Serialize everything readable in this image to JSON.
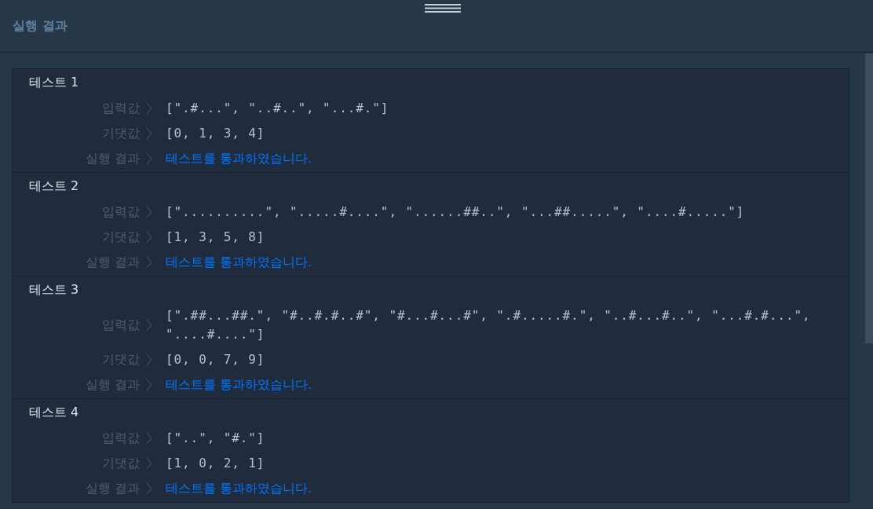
{
  "panel": {
    "title": "실행 결과"
  },
  "tests": [
    {
      "title": "테스트 1",
      "rows": [
        {
          "kind": "value",
          "label": "입력값",
          "value": "[\".#...\", \"..#..\", \"...#.\"]"
        },
        {
          "kind": "value",
          "label": "기댓값",
          "value": "[0, 1, 3, 4]"
        },
        {
          "kind": "result",
          "label": "실행 결과",
          "value": "테스트를 통과하였습니다.",
          "passed": true
        }
      ]
    },
    {
      "title": "테스트 2",
      "rows": [
        {
          "kind": "value",
          "label": "입력값",
          "value": "[\"..........\", \".....#....\", \"......##..\", \"...##.....\", \"....#.....\"]"
        },
        {
          "kind": "value",
          "label": "기댓값",
          "value": "[1, 3, 5, 8]"
        },
        {
          "kind": "result",
          "label": "실행 결과",
          "value": "테스트를 통과하였습니다.",
          "passed": true
        }
      ]
    },
    {
      "title": "테스트 3",
      "rows": [
        {
          "kind": "value",
          "label": "입력값",
          "value": "[\".##...##.\", \"#..#.#..#\", \"#...#...#\", \".#.....#.\", \"..#...#..\", \"...#.#...\", \"....#....\"]"
        },
        {
          "kind": "value",
          "label": "기댓값",
          "value": "[0, 0, 7, 9]"
        },
        {
          "kind": "result",
          "label": "실행 결과",
          "value": "테스트를 통과하였습니다.",
          "passed": true
        }
      ]
    },
    {
      "title": "테스트 4",
      "rows": [
        {
          "kind": "value",
          "label": "입력값",
          "value": "[\"..\", \"#.\"]"
        },
        {
          "kind": "value",
          "label": "기댓값",
          "value": "[1, 0, 2, 1]"
        },
        {
          "kind": "result",
          "label": "실행 결과",
          "value": "테스트를 통과하였습니다.",
          "passed": true
        }
      ]
    }
  ]
}
